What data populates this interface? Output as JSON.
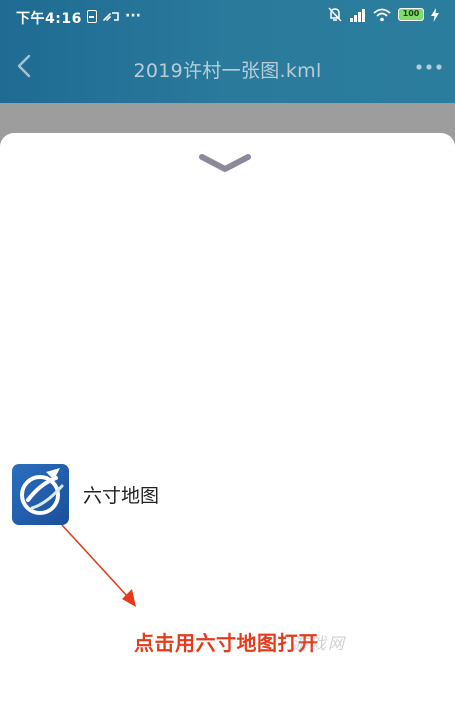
{
  "status_bar": {
    "time": "下午4:16",
    "more_indicator": "···",
    "battery_level": "100",
    "icons": [
      "sim-card-icon",
      "cast-icon",
      "mute-bell-icon",
      "cellular-signal-icon",
      "wifi-icon",
      "battery-icon",
      "charging-bolt-icon"
    ]
  },
  "title_bar": {
    "title": "2019许村一张图.kml",
    "back_icon": "chevron-left-icon",
    "more_icon": "more-dots-icon"
  },
  "open_with_sheet": {
    "handle_icon": "chevron-down-icon",
    "apps": [
      {
        "name": "六寸地图",
        "icon": "liucun-map-app-icon"
      }
    ]
  },
  "annotation": {
    "text": "点击用六寸地图打开",
    "color": "#e53b1c"
  },
  "watermark": {
    "text": "游戏网"
  },
  "colors": {
    "header": "#2a7a9c",
    "sheet": "#ffffff",
    "dim_overlay": "#9c9c9c",
    "annotation": "#e53b1c"
  }
}
